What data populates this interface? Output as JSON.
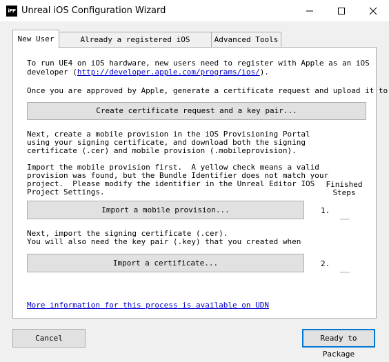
{
  "window": {
    "title": "Unreal iOS Configuration Wizard",
    "icon_label": "iPP"
  },
  "tabs": [
    {
      "label": "New User",
      "active": true
    },
    {
      "label": "Already a registered iOS developer",
      "active": false
    },
    {
      "label": "Advanced Tools",
      "active": false
    }
  ],
  "new_user": {
    "intro_line1": "To run UE4 on iOS hardware, new users need to register with Apple as an iOS",
    "intro_line2_prefix": "developer (",
    "intro_link": "http://developer.apple.com/programs/ios/",
    "intro_line2_suffix": ").",
    "approved_text": "Once you are approved by Apple, generate a certificate request and upload it to",
    "create_cert_button": "Create certificate request and a key pair...",
    "provision_text": "Next, create a mobile provision in the iOS Provisioning Portal\nusing your signing certificate, and download both the signing\ncertificate (.cer) and mobile provision (.mobileprovision).",
    "import_text": "Import the mobile provision first.  A yellow check means a valid\nprovision was found, but the Bundle Identifier does not match your\nproject.  Please modify the identifier in the Unreal Editor IOS\nProject Settings.",
    "finished_steps_label": "Finished\nSteps",
    "import_provision_button": "Import a mobile provision...",
    "step1_label": "1.",
    "cert_text": "Next, import the signing certificate (.cer).\nYou will also need the key pair (.key) that you created when",
    "import_cert_button": "Import a certificate...",
    "step2_label": "2.",
    "udn_link": "More information for this process is available on UDN"
  },
  "footer": {
    "cancel_label": "Cancel",
    "ready_label": "Ready to Package"
  },
  "colors": {
    "link": "#0000cc",
    "default_button_border": "#0078d7"
  }
}
